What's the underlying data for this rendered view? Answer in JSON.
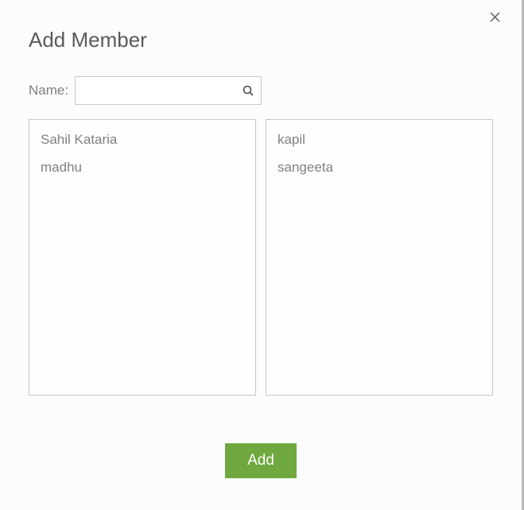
{
  "dialog": {
    "title": "Add Member",
    "name_label": "Name:",
    "search_value": "",
    "left_list": [
      "Sahil Kataria",
      "madhu"
    ],
    "right_list": [
      "kapil",
      "sangeeta"
    ],
    "add_button_label": "Add"
  }
}
